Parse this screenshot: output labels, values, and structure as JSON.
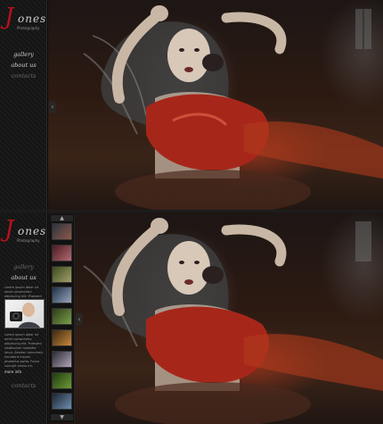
{
  "logo": {
    "initial": "J",
    "rest": "ones",
    "subtitle": "Photography"
  },
  "top_nav": [
    {
      "label": "gallery",
      "active": true
    },
    {
      "label": "about us",
      "active": true
    },
    {
      "label": "contacts",
      "active": false
    }
  ],
  "bottom_nav": [
    {
      "label": "gallery",
      "active": false
    },
    {
      "label": "about us",
      "active": true
    },
    {
      "label": "contacts",
      "active": false
    }
  ],
  "about": {
    "intro": "Lorem ipsum dolor sit amet consectetur adipiscing elit. Praesent vestibulum.",
    "body": "Lorem ipsum dolor sit amet consectetur adipiscing elit. Praesent vestibulum molestie lacus. Aenean nonummy hendrerit mauris phasellus porta. Fusce suscipit varius mi.",
    "read_more": "more info"
  },
  "thumbnails": [
    {
      "name": "thumb-1",
      "colors": [
        "#2c3340",
        "#8c5a48"
      ]
    },
    {
      "name": "thumb-2",
      "colors": [
        "#4a1a22",
        "#b36a72"
      ]
    },
    {
      "name": "thumb-3",
      "colors": [
        "#3a4a1c",
        "#a3a06a"
      ]
    },
    {
      "name": "thumb-4",
      "colors": [
        "#1c2f4a",
        "#9aa6b8"
      ]
    },
    {
      "name": "thumb-5",
      "colors": [
        "#2c3a1a",
        "#7aa04a"
      ]
    },
    {
      "name": "thumb-6",
      "colors": [
        "#3a2812",
        "#c8873a"
      ]
    },
    {
      "name": "thumb-7",
      "colors": [
        "#2a2a33",
        "#b2a5b8"
      ]
    },
    {
      "name": "thumb-8",
      "colors": [
        "#203a10",
        "#6d9a36"
      ]
    },
    {
      "name": "thumb-9",
      "colors": [
        "#1a2430",
        "#6f8fb0"
      ]
    }
  ],
  "colors": {
    "accent": "#b5121b",
    "sidebar_bg": "#161616",
    "text": "#cfcfcf"
  }
}
